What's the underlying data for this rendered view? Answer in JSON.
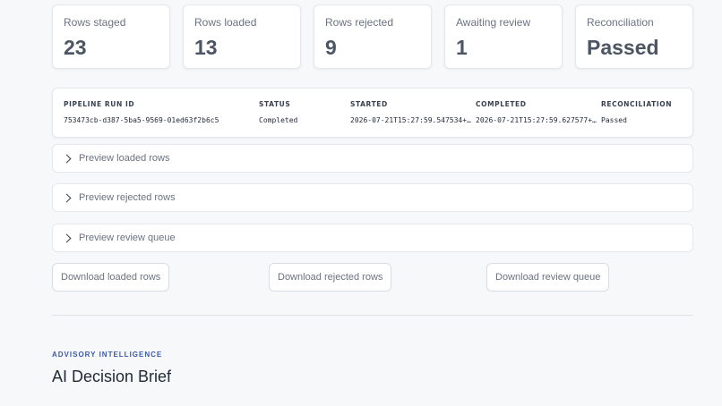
{
  "metrics": [
    {
      "label": "Rows staged",
      "value": "23"
    },
    {
      "label": "Rows loaded",
      "value": "13"
    },
    {
      "label": "Rows rejected",
      "value": "9"
    },
    {
      "label": "Awaiting review",
      "value": "1"
    },
    {
      "label": "Reconciliation",
      "value": "Passed"
    }
  ],
  "run": {
    "headers": [
      "PIPELINE RUN ID",
      "STATUS",
      "STARTED",
      "COMPLETED",
      "RECONCILIATION"
    ],
    "values": [
      "753473cb-d387-5ba5-9569-01ed63f2b6c5",
      "Completed",
      "2026-07-21T15:27:59.547534+…",
      "2026-07-21T15:27:59.627577+…",
      "Passed"
    ]
  },
  "expanders": [
    "Preview loaded rows",
    "Preview rejected rows",
    "Preview review queue"
  ],
  "downloads": [
    "Download loaded rows",
    "Download rejected rows",
    "Download review queue"
  ],
  "advisory": {
    "eyebrow": "ADVISORY INTELLIGENCE",
    "title": "AI Decision Brief"
  }
}
